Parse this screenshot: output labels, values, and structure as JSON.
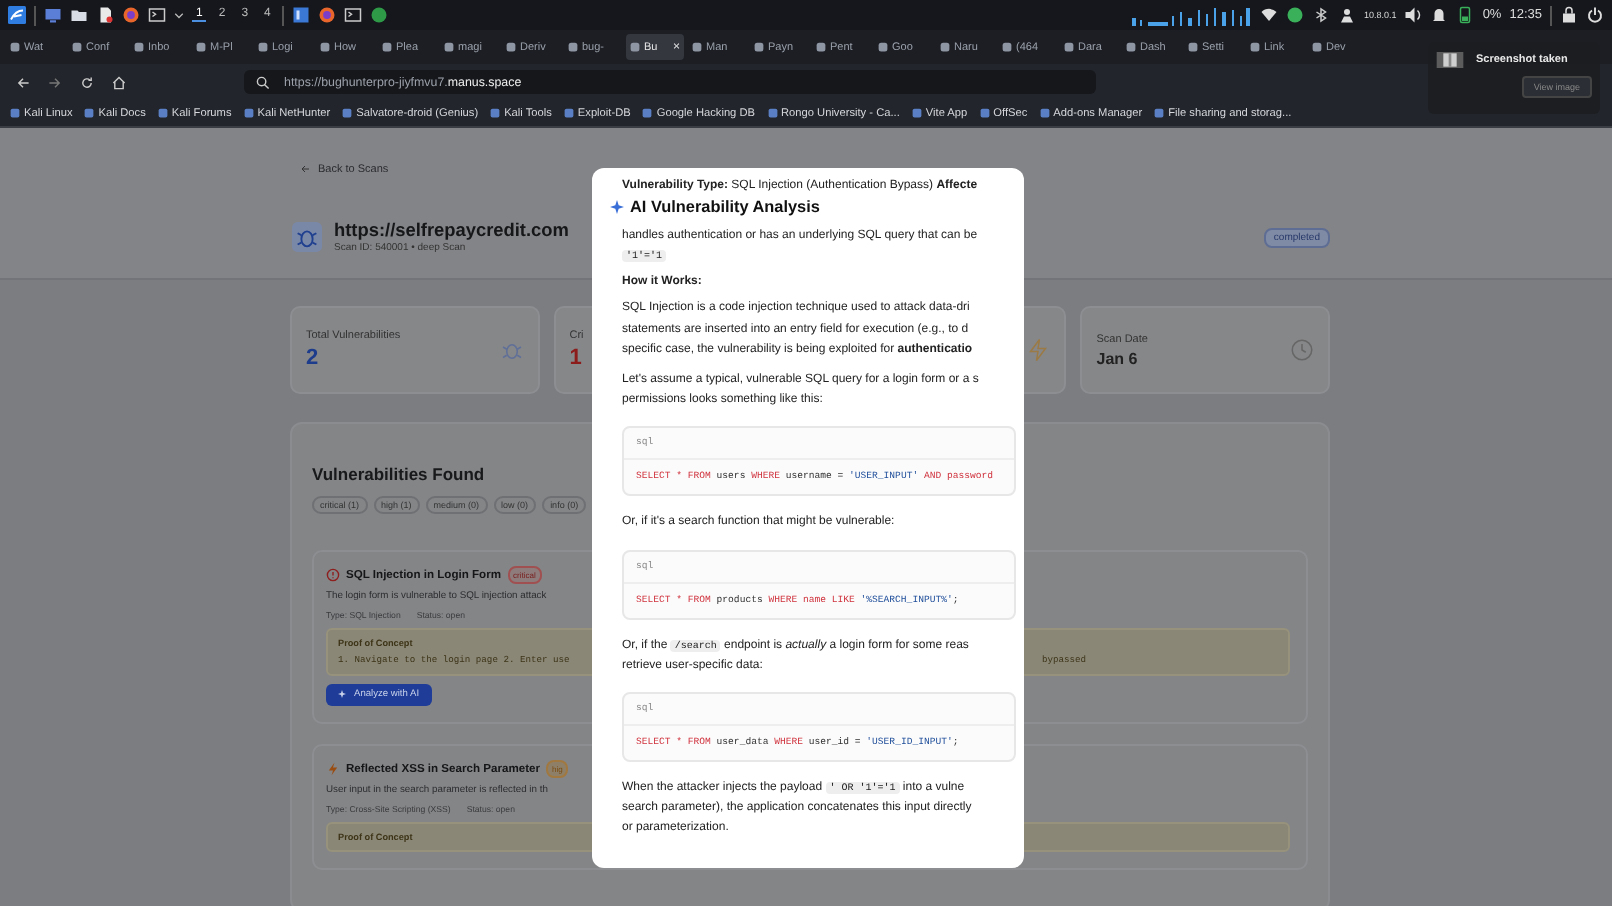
{
  "taskbar": {
    "workspaces": [
      {
        "label": "1",
        "selected": true
      },
      {
        "label": "2",
        "selected": false
      },
      {
        "label": "3",
        "selected": false
      },
      {
        "label": "4",
        "selected": false
      }
    ],
    "ip": "10.8.0.1",
    "battery": "0%",
    "time": "12:35"
  },
  "browser": {
    "tabs": [
      {
        "label": "Wat",
        "selected": false
      },
      {
        "label": "Conf",
        "selected": false
      },
      {
        "label": "Inbo",
        "selected": false
      },
      {
        "label": "M-Pl",
        "selected": false
      },
      {
        "label": "Logi",
        "selected": false
      },
      {
        "label": "How",
        "selected": false
      },
      {
        "label": "Plea",
        "selected": false
      },
      {
        "label": "magi",
        "selected": false
      },
      {
        "label": "Deriv",
        "selected": false
      },
      {
        "label": "bug-",
        "selected": false
      },
      {
        "label": "Bu",
        "selected": true
      },
      {
        "label": "Man",
        "selected": false
      },
      {
        "label": "Payn",
        "selected": false
      },
      {
        "label": "Pent",
        "selected": false
      },
      {
        "label": "Goo",
        "selected": false
      },
      {
        "label": "Naru",
        "selected": false
      },
      {
        "label": "(464",
        "selected": false
      },
      {
        "label": "Dara",
        "selected": false
      },
      {
        "label": "Dash",
        "selected": false
      },
      {
        "label": "Setti",
        "selected": false
      },
      {
        "label": "Link",
        "selected": false
      },
      {
        "label": "Dev",
        "selected": false
      }
    ],
    "close_tab": "×",
    "url_base": "https://bughunterpro-jiyfmvu7.",
    "url_domain": "manus.space",
    "bookmarks": [
      "Kali Linux",
      "Kali Docs",
      "Kali Forums",
      "Kali NetHunter",
      "Salvatore-droid (Genius)",
      "Kali Tools",
      "Exploit-DB",
      "Google Hacking DB",
      "Rongo University - Ca...",
      "Vite App",
      "OffSec",
      "Add-ons Manager",
      "File sharing and storag..."
    ]
  },
  "notification": {
    "title": "Screenshot taken",
    "button": "View image"
  },
  "page": {
    "back": "Back to Scans",
    "title": "https://selfrepaycredit.com",
    "subtitle": "Scan ID: 540001 • deep Scan",
    "status": "completed",
    "stats": [
      {
        "kind": "total",
        "label": "Total Vulnerabilities",
        "value": "2"
      },
      {
        "kind": "critical",
        "label": "Cri",
        "value": "1"
      },
      {
        "kind": "bolt"
      },
      {
        "kind": "date",
        "label": "Scan Date",
        "value": "Jan 6"
      }
    ],
    "section_title": "Vulnerabilities Found",
    "filters": [
      "critical (1)",
      "high (1)",
      "medium (0)",
      "low (0)",
      "info (0)"
    ],
    "vulnerabilities": [
      {
        "kind": "critical",
        "title": "SQL Injection in Login Form",
        "badge": "critical",
        "description": "The login form is vulnerable to SQL injection attack",
        "type": "Type: SQL Injection",
        "status": "Status: open",
        "poc_title": "Proof of Concept",
        "poc_left": "1. Navigate to the login page 2. Enter use",
        "poc_right": "bypassed",
        "button": "Analyze with AI"
      },
      {
        "kind": "high",
        "title": "Reflected XSS in Search Parameter",
        "badge": "hig",
        "description": "User input in the search parameter is reflected in th",
        "type": "Type: Cross-Site Scripting (XSS)",
        "status": "Status: open",
        "poc_title": "Proof of Concept"
      }
    ]
  },
  "modal": {
    "top_line": "**Vulnerability Type:** SQL Injection (Authentication Bypass) **Affecte**",
    "title": "AI Vulnerability Analysis",
    "blocks": [
      {
        "kind": "para",
        "lines": [
          [
            {
              "kind": "text",
              "text": "handles authentication or has an underlying SQL query that can be"
            }
          ],
          [
            {
              "kind": "code",
              "text": "'1'='1"
            }
          ]
        ]
      },
      {
        "kind": "heading",
        "text": "How it Works:"
      },
      {
        "kind": "para",
        "lines": [
          [
            {
              "kind": "text",
              "text": "SQL Injection is a code injection technique used to attack data-dri"
            }
          ],
          [
            {
              "kind": "text",
              "text": "statements are inserted into an entry field for execution (e.g., to d"
            }
          ],
          [
            {
              "kind": "text",
              "text": "specific case, the vulnerability is being exploited for **authenticatio**"
            }
          ]
        ]
      },
      {
        "kind": "para",
        "lines": [
          [
            {
              "kind": "text",
              "text": "Let's assume a typical, vulnerable SQL query for a login form or a s"
            }
          ],
          [
            {
              "kind": "text",
              "text": "permissions looks something like this:"
            }
          ]
        ]
      },
      {
        "kind": "code",
        "lang": "sql",
        "tokens": [
          {
            "kind": "keyword",
            "text": "SELECT * FROM"
          },
          {
            "kind": "plain",
            "text": " users "
          },
          {
            "kind": "keyword",
            "text": "WHERE"
          },
          {
            "kind": "plain",
            "text": " username = "
          },
          {
            "kind": "string",
            "text": "'USER_INPUT'"
          },
          {
            "kind": "keyword",
            "text": " AND password"
          }
        ]
      },
      {
        "kind": "para",
        "lines": [
          [
            {
              "kind": "text",
              "text": "Or, if it's a search function that might be vulnerable:"
            }
          ]
        ]
      },
      {
        "kind": "code",
        "lang": "sql",
        "tokens": [
          {
            "kind": "keyword",
            "text": "SELECT * FROM"
          },
          {
            "kind": "plain",
            "text": " products "
          },
          {
            "kind": "keyword",
            "text": "WHERE name LIKE "
          },
          {
            "kind": "string",
            "text": "'%SEARCH_INPUT%'"
          },
          {
            "kind": "plain",
            "text": ";"
          }
        ]
      },
      {
        "kind": "para",
        "lines": [
          [
            {
              "kind": "text",
              "text": "Or, if the "
            },
            {
              "kind": "code",
              "text": "/search"
            },
            {
              "kind": "text",
              "text": " endpoint is *actually* a login form for some reas"
            }
          ],
          [
            {
              "kind": "text",
              "text": "retrieve user-specific data:"
            }
          ]
        ]
      },
      {
        "kind": "code",
        "lang": "sql",
        "tokens": [
          {
            "kind": "keyword",
            "text": "SELECT * FROM"
          },
          {
            "kind": "plain",
            "text": " user_data "
          },
          {
            "kind": "keyword",
            "text": "WHERE"
          },
          {
            "kind": "plain",
            "text": " user_id = "
          },
          {
            "kind": "string",
            "text": "'USER_ID_INPUT'"
          },
          {
            "kind": "plain",
            "text": ";"
          }
        ]
      },
      {
        "kind": "para",
        "lines": [
          [
            {
              "kind": "text",
              "text": "When the attacker injects the payload "
            },
            {
              "kind": "code",
              "text": "' OR '1'='1"
            },
            {
              "kind": "text",
              "text": " into a vulne"
            }
          ],
          [
            {
              "kind": "text",
              "text": "search parameter), the application concatenates this input directly"
            }
          ],
          [
            {
              "kind": "text",
              "text": "or parameterization."
            }
          ]
        ]
      }
    ]
  }
}
